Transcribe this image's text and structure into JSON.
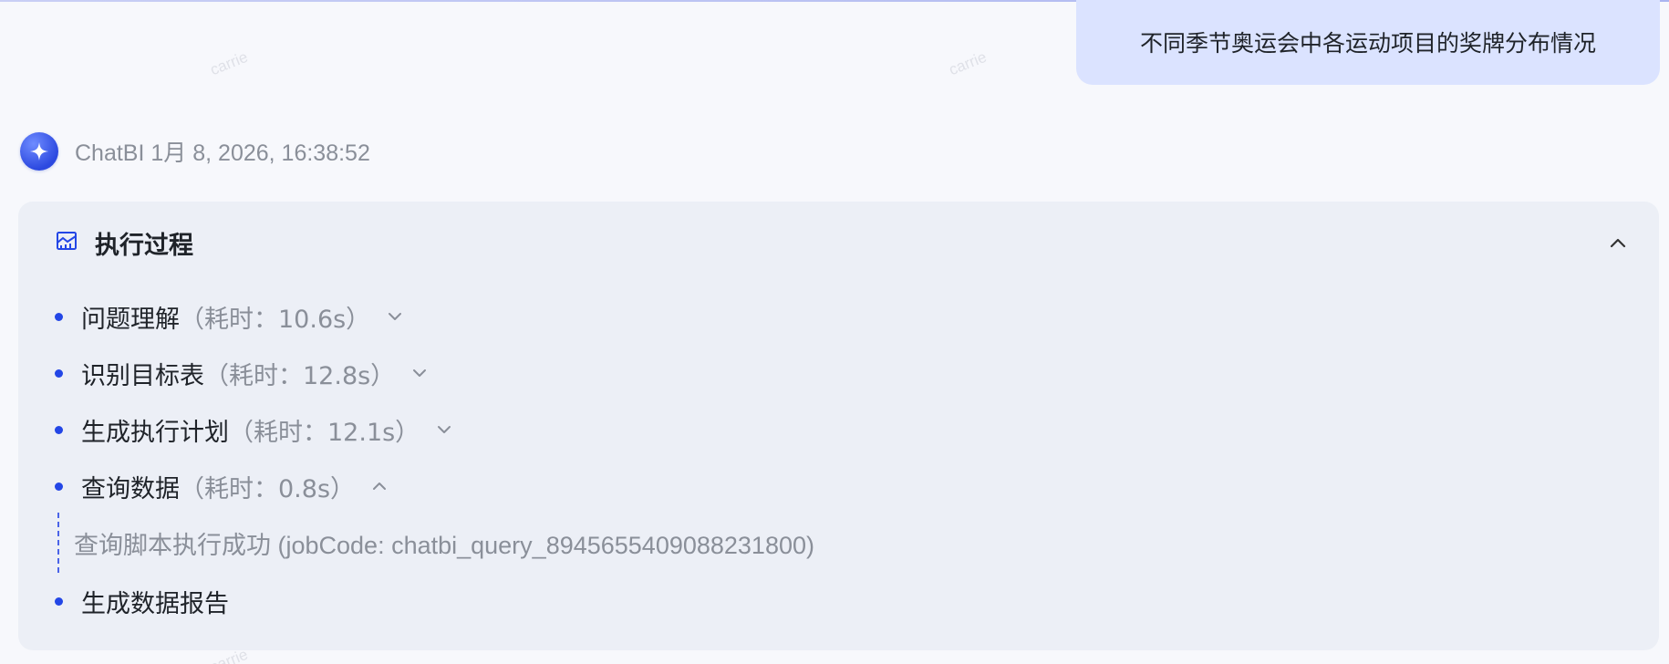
{
  "user_message": "不同季节奥运会中各运动项目的奖牌分布情况",
  "assistant": {
    "name": "ChatBI",
    "timestamp": "1月 8, 2026, 16:38:52"
  },
  "panel": {
    "title": "执行过程",
    "steps": [
      {
        "label": "问题理解",
        "time": "（耗时：10.6s）"
      },
      {
        "label": "识别目标表",
        "time": "（耗时：12.8s）"
      },
      {
        "label": "生成执行计划",
        "time": "（耗时：12.1s）"
      },
      {
        "label": "查询数据",
        "time": "（耗时：0.8s）",
        "detail": "查询脚本执行成功 (jobCode: chatbi_query_894565540908823180​0)"
      },
      {
        "label": "生成数据报告",
        "time": ""
      }
    ]
  },
  "watermark": "carrie",
  "colors": {
    "accent": "#2346e6",
    "bubble": "#dbe3ff",
    "panel": "#eceff6"
  }
}
